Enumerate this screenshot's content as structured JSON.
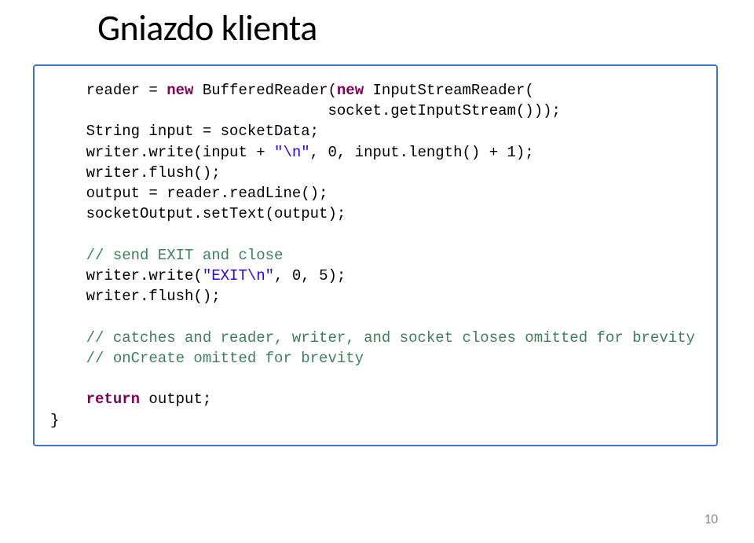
{
  "title": "Gniazdo klienta",
  "pageNumber": "10",
  "code": {
    "l1a": "    reader = ",
    "l1b": "new",
    "l1c": " BufferedReader(",
    "l1d": "new",
    "l1e": " InputStreamReader(",
    "l2": "                               socket.getInputStream()));",
    "l3": "    String input = socketData;",
    "l4a": "    writer.write(input + ",
    "l4b": "\"\\n\"",
    "l4c": ", 0, input.length() + 1);",
    "l5": "    writer.flush();",
    "l6": "    output = reader.readLine();",
    "l7": "    socketOutput.setText(output);",
    "l8": "",
    "l9a": "    ",
    "l9b": "// send EXIT and close",
    "l10a": "    writer.write(",
    "l10b": "\"EXIT\\n\"",
    "l10c": ", 0, 5);",
    "l11": "    writer.flush();",
    "l12": "",
    "l13a": "    ",
    "l13b": "// catches and reader, writer, and socket closes omitted for brevity",
    "l14a": "    ",
    "l14b": "// onCreate omitted for brevity",
    "l15": "",
    "l16a": "    ",
    "l16b": "return",
    "l16c": " output;",
    "l17": "}"
  }
}
